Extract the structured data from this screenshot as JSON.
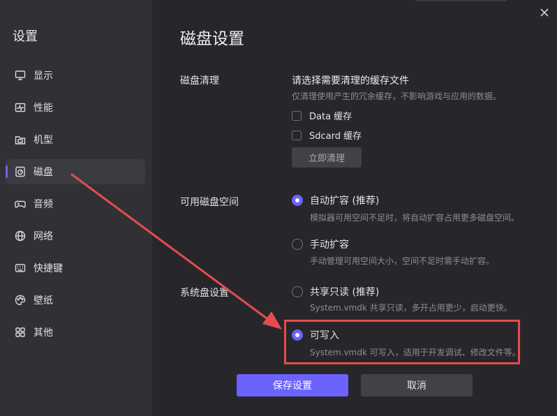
{
  "sidebar": {
    "title": "设置",
    "items": [
      {
        "label": "显示",
        "icon": "monitor-icon"
      },
      {
        "label": "性能",
        "icon": "performance-icon"
      },
      {
        "label": "机型",
        "icon": "device-model-icon"
      },
      {
        "label": "磁盘",
        "icon": "disk-icon",
        "active": true
      },
      {
        "label": "音频",
        "icon": "gamepad-icon"
      },
      {
        "label": "网络",
        "icon": "globe-icon"
      },
      {
        "label": "快捷键",
        "icon": "keyboard-icon"
      },
      {
        "label": "壁纸",
        "icon": "palette-icon"
      },
      {
        "label": "其他",
        "icon": "grid-icon"
      }
    ]
  },
  "page": {
    "title": "磁盘设置"
  },
  "disk_cleanup": {
    "label": "磁盘清理",
    "heading": "请选择需要清理的缓存文件",
    "description": "仅清理使用产生的冗余缓存，不影响游戏与应用的数据。",
    "options": [
      {
        "label": "Data 缓存",
        "checked": false
      },
      {
        "label": "Sdcard 缓存",
        "checked": false
      }
    ],
    "button_label": "立即清理"
  },
  "available_space": {
    "label": "可用磁盘空间",
    "options": [
      {
        "label": "自动扩容 (推荐)",
        "description": "模拟器可用空间不足时，将自动扩容占用更多磁盘空间。",
        "checked": true
      },
      {
        "label": "手动扩容",
        "description": "手动管理可用空间大小，空间不足时需手动扩容。",
        "checked": false
      }
    ]
  },
  "system_disk": {
    "label": "系统盘设置",
    "options": [
      {
        "label": "共享只读 (推荐)",
        "description": "System.vmdk 共享只读，多开占用更少，启动更快。",
        "checked": false
      },
      {
        "label": "可写入",
        "description": "System.vmdk 可写入，适用于开发调试、修改文件等。",
        "checked": true
      }
    ]
  },
  "footer": {
    "save_label": "保存设置",
    "cancel_label": "取消"
  },
  "colors": {
    "accent": "#6c63ff",
    "annotation": "#e74c4c",
    "background": "#27272b",
    "sidebar": "#303035"
  }
}
